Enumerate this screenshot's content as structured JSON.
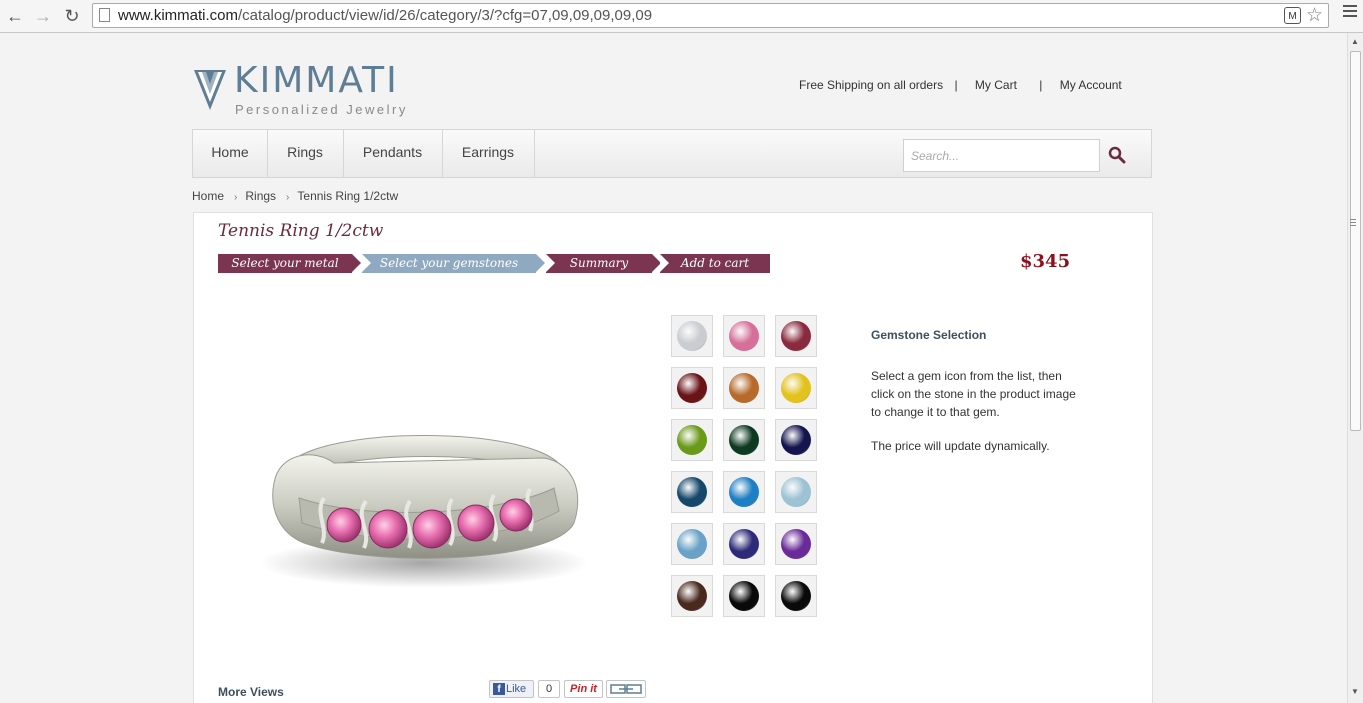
{
  "browser": {
    "url_host": "www.kimmati.com",
    "url_path": "/catalog/product/view/id/26/category/3/?cfg=07,09,09,09,09,09"
  },
  "header": {
    "brand": "KIMMATI",
    "tagline": "Personalized Jewelry",
    "links": {
      "shipping": "Free Shipping on all orders",
      "cart": "My Cart",
      "account": "My Account",
      "separator": "|"
    }
  },
  "nav": {
    "items": [
      "Home",
      "Rings",
      "Pendants",
      "Earrings"
    ],
    "search_placeholder": "Search..."
  },
  "breadcrumb": [
    "Home",
    "Rings",
    "Tennis Ring 1/2ctw"
  ],
  "product": {
    "title": "Tennis Ring 1/2ctw",
    "price": "$345",
    "steps": [
      "Select your metal",
      "Select your gemstones",
      "Summary",
      "Add to cart"
    ],
    "active_step": 1
  },
  "gemstones": {
    "heading": "Gemstone Selection",
    "instructions": "Select a gem icon from the list, then click on the stone in the product image to change it to that gem.",
    "price_note": "The price will update dynamically.",
    "colors": [
      "#c9ccd1",
      "#d6709a",
      "#8a2a3e",
      "#6a1418",
      "#b86a2a",
      "#e3c21c",
      "#6a9a1a",
      "#0e3a22",
      "#14154e",
      "#15486a",
      "#1f7fc4",
      "#9cc2d3",
      "#6aa2c7",
      "#2e2a7a",
      "#6a2a9a",
      "#4a2a1e",
      "#0a0a0a",
      "#0a0a0a"
    ]
  },
  "footer": {
    "more_views": "More Views",
    "like_label": "Like",
    "like_count": "0",
    "pin_label": "Pin it"
  }
}
